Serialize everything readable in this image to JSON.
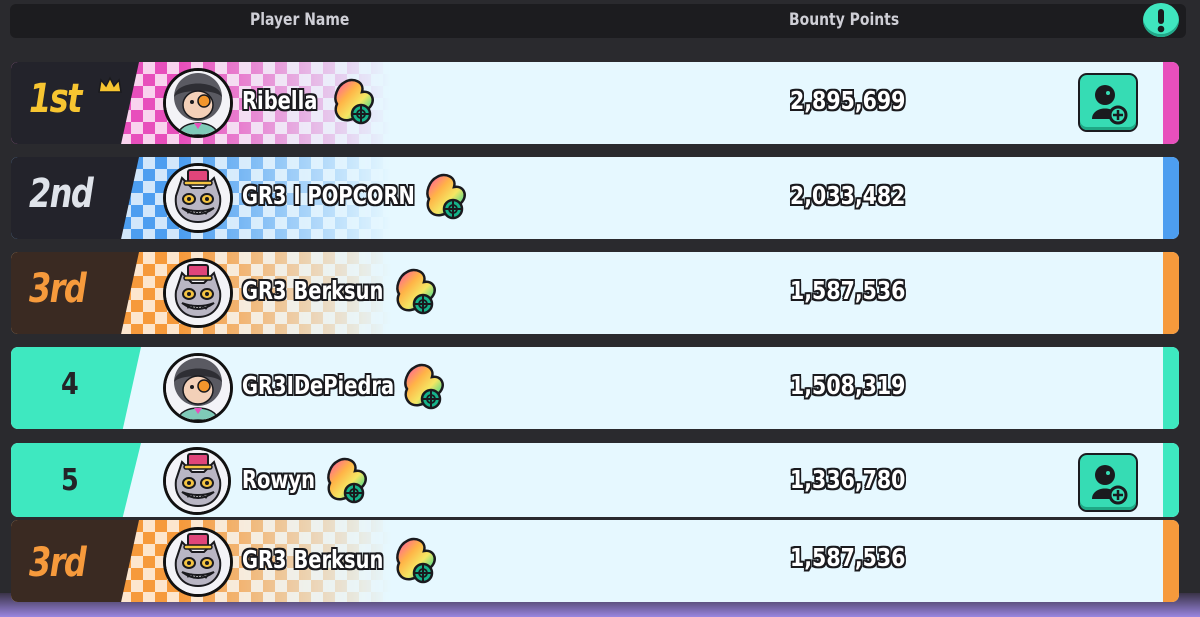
{
  "header": {
    "player_name_label": "Player Name",
    "bounty_points_label": "Bounty Points",
    "alert_icon": "exclamation-icon"
  },
  "colors": {
    "gold": "#f7c531",
    "pink": "#e84fbc",
    "blue": "#4d9ef0",
    "orange": "#f69a3c",
    "teal": "#3ee8c0",
    "row_bg": "#e6f8ff"
  },
  "rows": [
    {
      "rank": "1st",
      "name": "Ribella",
      "points": "2,895,699",
      "avatar": "ribella-avatar",
      "add_friend": true
    },
    {
      "rank": "2nd",
      "name": "GR3 I POPCORN",
      "points": "2,033,482",
      "avatar": "cat-avatar",
      "add_friend": false
    },
    {
      "rank": "3rd",
      "name": "GR3 Berksun",
      "points": "1,587,536",
      "avatar": "cat-avatar",
      "add_friend": false
    },
    {
      "rank": "4",
      "name": "GR3IDePiedra",
      "points": "1,508,319",
      "avatar": "ribella-avatar",
      "add_friend": false
    },
    {
      "rank": "5",
      "name": "Rowyn",
      "points": "1,336,780",
      "avatar": "cat-avatar",
      "add_friend": true
    },
    {
      "rank": "3rd",
      "name": "GR3 Berksun",
      "points": "1,587,536",
      "avatar": "cat-avatar",
      "add_friend": false
    }
  ]
}
